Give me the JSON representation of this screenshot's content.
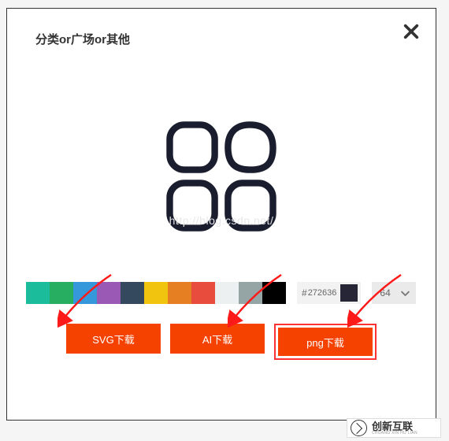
{
  "title": "分类or广场or其他",
  "watermark": "http://blog.csdn.net/",
  "palette": [
    {
      "color": "#1abc9c"
    },
    {
      "color": "#27ae60"
    },
    {
      "color": "#3498db"
    },
    {
      "color": "#9b59b6"
    },
    {
      "color": "#34495e"
    },
    {
      "color": "#f1c40f"
    },
    {
      "color": "#e67e22"
    },
    {
      "color": "#e74c3c"
    },
    {
      "color": "#ecf0f1"
    },
    {
      "color": "#95a5a6"
    },
    {
      "color": "#000000"
    }
  ],
  "hex": {
    "hash": "#",
    "value": "272636"
  },
  "size": {
    "value": "64"
  },
  "buttons": {
    "svg": "SVG下载",
    "ai": "AI下载",
    "png": "png下载"
  },
  "logo": {
    "main": "创新互联",
    "sub": "CHUANG XIN HU LIAN"
  }
}
